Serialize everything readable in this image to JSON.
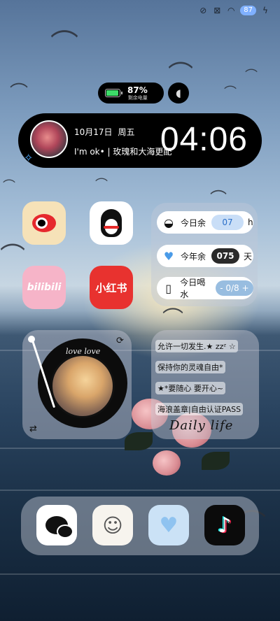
{
  "status_bar": {
    "icons": [
      "vibrate-off-icon",
      "no-sim-icon",
      "wifi-icon",
      "battery-heart-icon",
      "charging-icon"
    ],
    "battery_level": "87"
  },
  "battery_widget": {
    "percent": "87%",
    "label": "剩余电量",
    "level": 0.87
  },
  "clock_widget": {
    "date": "10月17日",
    "weekday": "周五",
    "signature": "I'm ok• | 玫瑰和大海更配",
    "time": "04:06"
  },
  "apps": {
    "weibo": "weibo-icon",
    "qq": "qq-penguin-icon",
    "bilibili": "bilibili",
    "xiaohongshu": "小红书"
  },
  "countdown_widget": {
    "rows": [
      {
        "icon": "coconut-icon",
        "label": "今日余",
        "value": "07",
        "unit": "h"
      },
      {
        "icon": "heart-icon",
        "label": "今年余",
        "value": "075",
        "unit": "天"
      },
      {
        "icon": "cup-icon",
        "label": "今日喝水",
        "value": "- 0/8 +"
      }
    ]
  },
  "music_widget": {
    "label": "love love"
  },
  "notes_widget": {
    "lines": [
      "允许一切发生.★ zzᶻ ☆",
      "保持你的灵魂自由*",
      "★*要随心 要开心~",
      "海浪盖章|自由认证PASS"
    ],
    "title": "Daily life"
  },
  "dock": {
    "apps": [
      "wechat-icon",
      "bunny-icon",
      "heart-cloud-icon",
      "tiktok-icon"
    ]
  },
  "colors": {
    "accent_blue": "#2a6fc9",
    "xhs_red": "#e8322f",
    "battery_green": "#3ddc68"
  }
}
